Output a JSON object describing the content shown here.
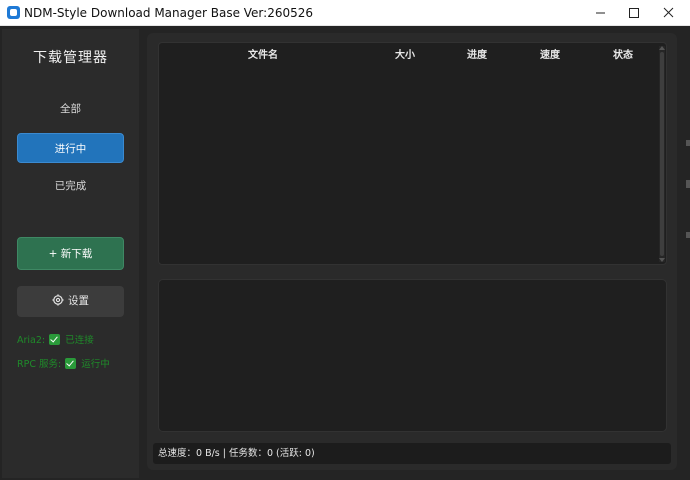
{
  "window": {
    "title": "NDM-Style Download Manager Base Ver:260526"
  },
  "titlebar": {
    "icons": [
      "app-icon",
      "minimize-icon",
      "maximize-icon",
      "close-icon"
    ]
  },
  "sidebar": {
    "title": "下载管理器",
    "nav": [
      {
        "label": "全部",
        "selected": false
      },
      {
        "label": "进行中",
        "selected": true
      },
      {
        "label": "已完成",
        "selected": false
      }
    ],
    "new_download_label": "+ 新下载",
    "settings_label": "设置",
    "settings_icon": "gear-icon",
    "status": {
      "aria_label": "Aria2:",
      "aria_value": "已连接",
      "rpc_label": "RPC 服务:",
      "rpc_value": "运行中"
    }
  },
  "table": {
    "columns": [
      "文件名",
      "大小",
      "进度",
      "速度",
      "状态"
    ],
    "rows": []
  },
  "statusbar": {
    "text": "总速度：0 B/s  |  任务数：0 (活跃: 0)"
  },
  "colors": {
    "accent": "#2274bb",
    "new_button": "#2e7250",
    "status_ok": "#1f8a2a",
    "background": "#242424"
  }
}
